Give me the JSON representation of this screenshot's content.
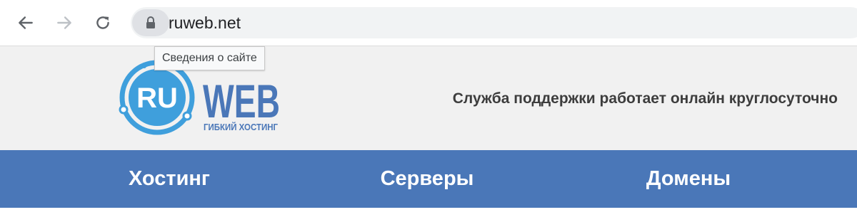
{
  "browser": {
    "url": "ruweb.net",
    "tooltip": "Сведения о сайте",
    "icons": {
      "back": "arrow-left-icon",
      "forward": "arrow-right-icon",
      "reload": "reload-icon",
      "lock": "lock-icon"
    }
  },
  "site": {
    "logo": {
      "ru": "RU",
      "web": "WEB",
      "tagline": "ГИБКИЙ ХОСТИНГ"
    },
    "support_text": "Служба поддержки работает онлайн круглосуточно",
    "nav": [
      "Хостинг",
      "Серверы",
      "Домены"
    ],
    "colors": {
      "brand_blue": "#4a77b8",
      "logo_light_blue": "#3f9fdc",
      "header_bg": "#f1f1f1"
    }
  }
}
